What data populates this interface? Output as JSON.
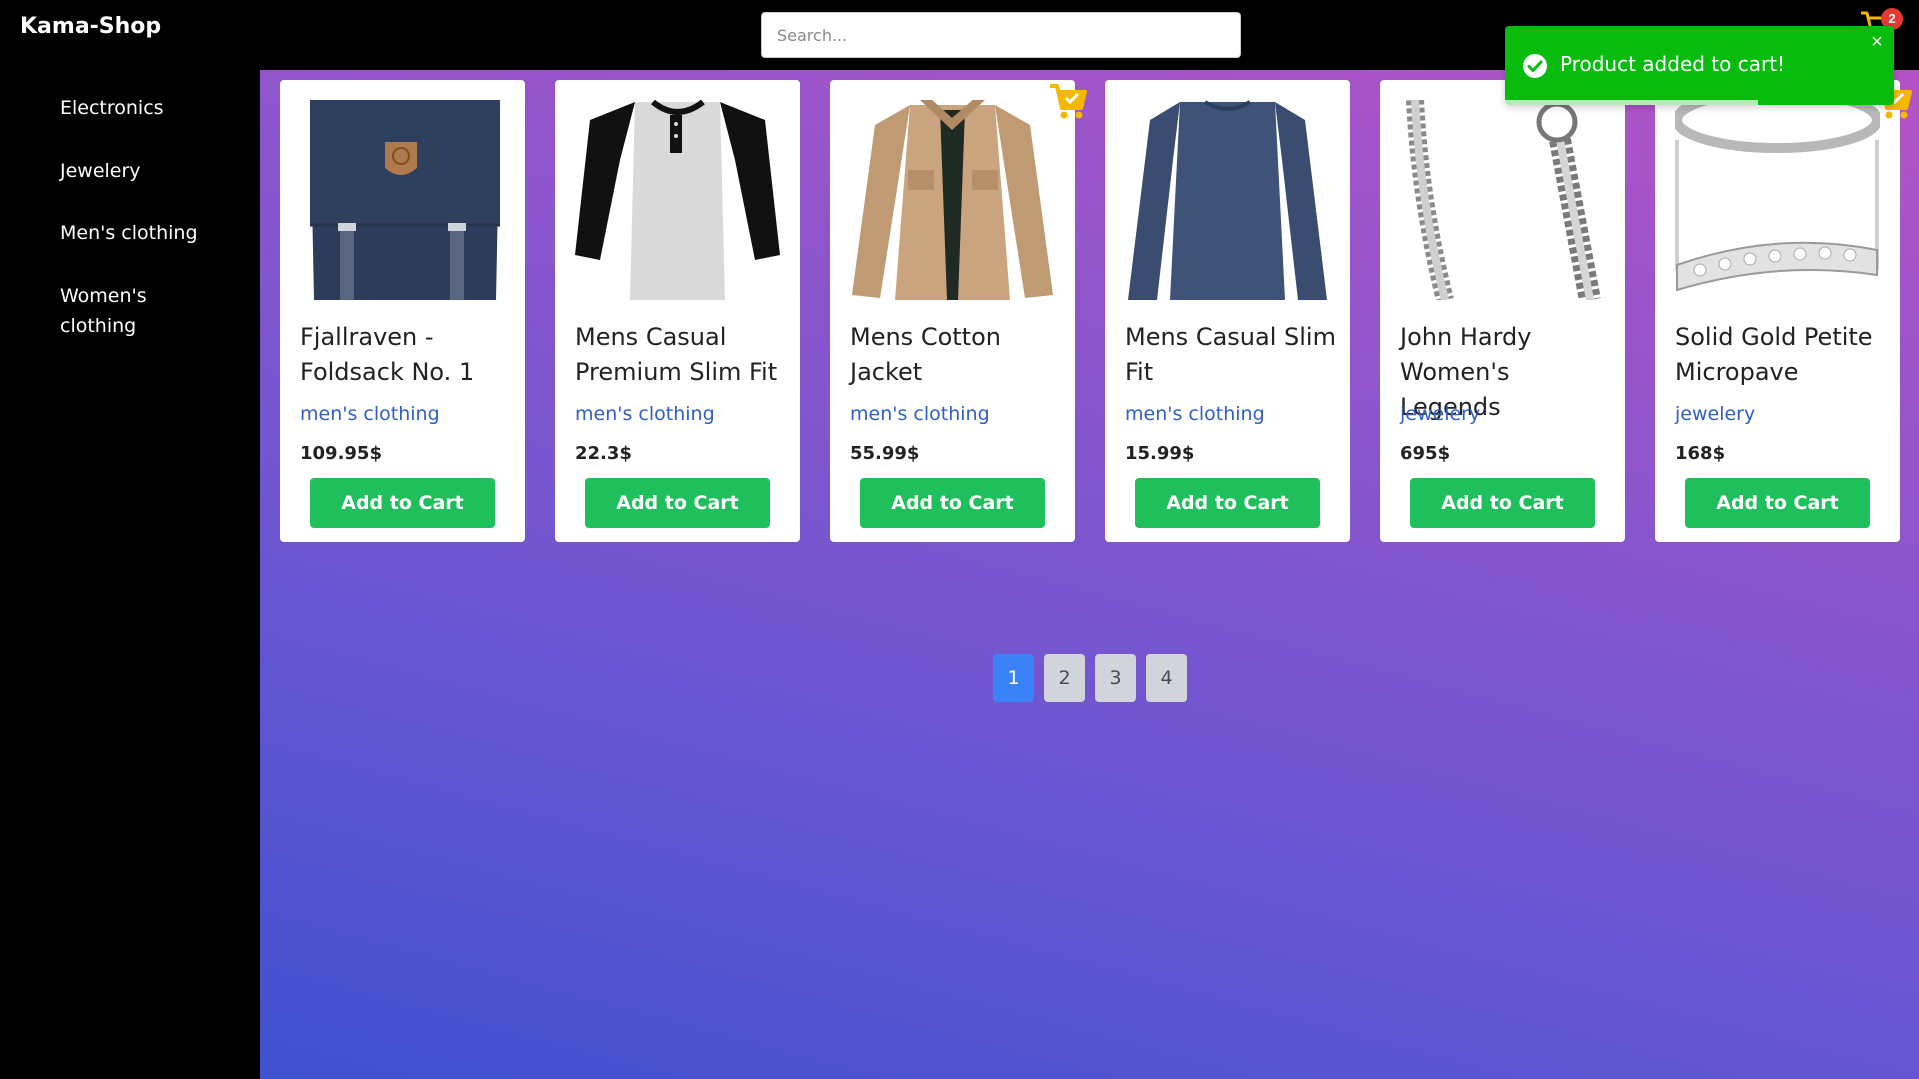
{
  "app": {
    "brand": "Kama-Shop"
  },
  "search": {
    "placeholder": "Search..."
  },
  "sidebar": {
    "items": [
      {
        "label": "Electronics"
      },
      {
        "label": "Jewelery"
      },
      {
        "label": "Men's clothing"
      },
      {
        "label": "Women's clothing"
      }
    ]
  },
  "products": [
    {
      "title": "Fjallraven - Foldsack No. 1",
      "category": "men's clothing",
      "price": "109.95$",
      "button": "Add to Cart"
    },
    {
      "title": "Mens Casual Premium Slim Fit",
      "category": "men's clothing",
      "price": "22.3$",
      "button": "Add to Cart"
    },
    {
      "title": "Mens Cotton Jacket",
      "category": "men's clothing",
      "price": "55.99$",
      "button": "Add to Cart"
    },
    {
      "title": "Mens Casual Slim Fit",
      "category": "men's clothing",
      "price": "15.99$",
      "button": "Add to Cart"
    },
    {
      "title": "John Hardy Women's Legends",
      "category": "jewelery",
      "price": "695$",
      "button": "Add to Cart"
    },
    {
      "title": "Solid Gold Petite Micropave",
      "category": "jewelery",
      "price": "168$",
      "button": "Add to Cart"
    }
  ],
  "pagination": {
    "pages": [
      "1",
      "2",
      "3",
      "4"
    ],
    "current": "1"
  },
  "toast": {
    "message": "Product added to cart!",
    "close": "×"
  },
  "cart": {
    "count": "2"
  },
  "colors": {
    "accent_green": "#1fbf5c",
    "toast_green": "#07bc0c",
    "category_blue": "#2f5fc7",
    "page_active": "#3b82f6",
    "badge_red": "#e53935",
    "cart_yellow": "#f5b800",
    "gradient": [
      "#3f51cf",
      "#6a56d2",
      "#8b55cc",
      "#b553c6"
    ]
  },
  "icons": {
    "cart": "shopping-cart-icon",
    "added": "cart-check-icon",
    "toast": "check-circle-icon",
    "close": "close-icon"
  }
}
